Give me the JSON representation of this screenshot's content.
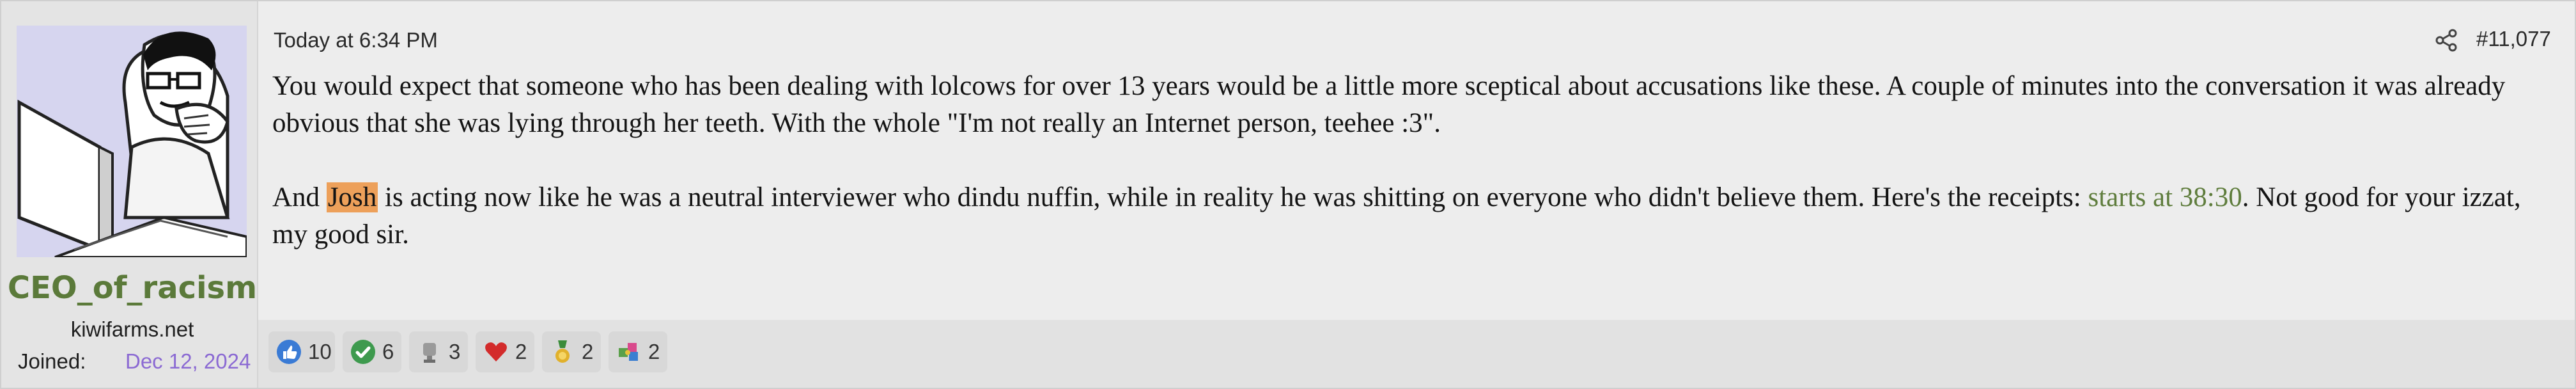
{
  "user": {
    "username": "CEO_of_racism",
    "title": "kiwifarms.net",
    "joined_label": "Joined:",
    "joined_date": "Dec 12, 2024"
  },
  "post": {
    "timestamp": "Today at 6:34 PM",
    "number": "#11,077",
    "p1": "You would expect that someone who has been dealing with lolcows for over 13 years would be a little more sceptical about accusations like these. A couple of minutes into the conversation it was already obvious that she was lying through her teeth. With the whole \"I'm not really an Internet person, teehee :3\".",
    "p2_pre": "And ",
    "p2_highlight": "Josh",
    "p2_mid": " is acting now like he was a neutral interviewer who dindu nuffin, while in reality he was shitting on everyone who didn't believe them. Here's the receipts: ",
    "p2_link": "starts at 38:30",
    "p2_post": ". Not good for your izzat, my good sir."
  },
  "reactions": [
    {
      "icon": "thumbs-up-icon",
      "count": "10"
    },
    {
      "icon": "checkmark-icon",
      "count": "6"
    },
    {
      "icon": "trophy-icon",
      "count": "3"
    },
    {
      "icon": "heart-icon",
      "count": "2"
    },
    {
      "icon": "medal-icon",
      "count": "2"
    },
    {
      "icon": "puzzle-icon",
      "count": "2"
    }
  ],
  "colors": {
    "username": "#5b7a3a",
    "joined_date": "#8b6ad3",
    "highlight": "#eda05a",
    "link": "#5f7d3d"
  }
}
